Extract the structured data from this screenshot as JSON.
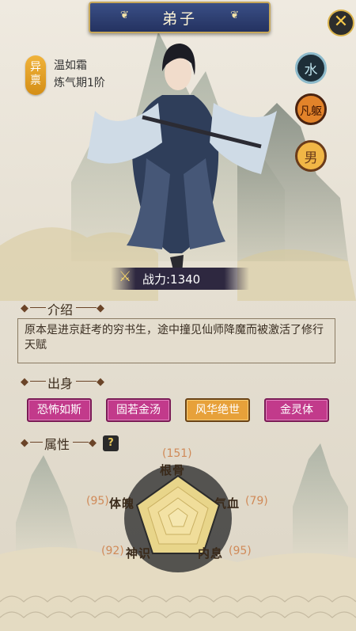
{
  "header": {
    "title": "弟子"
  },
  "character": {
    "rank_badge": "异禀",
    "name": "温如霜",
    "realm": "炼气期1阶",
    "element_badge": "水",
    "body_badge": "凡躯",
    "gender_badge": "男"
  },
  "power": {
    "label": "战力:1340"
  },
  "sections": {
    "intro_title": "介绍",
    "intro_text": "原本是进京赶考的穷书生，途中撞见仙师降魔而被激活了修行天赋",
    "origin_title": "出身",
    "attributes_title": "属性"
  },
  "origin_tags": [
    {
      "label": "恐怖如斯",
      "style": "pink"
    },
    {
      "label": "固若金汤",
      "style": "pink"
    },
    {
      "label": "风华绝世",
      "style": "gold"
    },
    {
      "label": "金灵体",
      "style": "pink"
    }
  ],
  "attributes": {
    "help_icon": "?",
    "stats": [
      {
        "name": "根骨",
        "value": "(151)"
      },
      {
        "name": "气血",
        "value": "(79)"
      },
      {
        "name": "内息",
        "value": "(95)"
      },
      {
        "name": "神识",
        "value": "(92)"
      },
      {
        "name": "体魄",
        "value": "(95)"
      }
    ]
  },
  "colors": {
    "title_bar": "#2f4173",
    "rank_badge": "#e9a22d",
    "tag_pink": "#c23a8b",
    "tag_gold": "#e7a13a",
    "stat_value": "#d08a58"
  },
  "icons": {
    "close": "close-icon",
    "power": "sword-icon",
    "help": "question-icon"
  }
}
